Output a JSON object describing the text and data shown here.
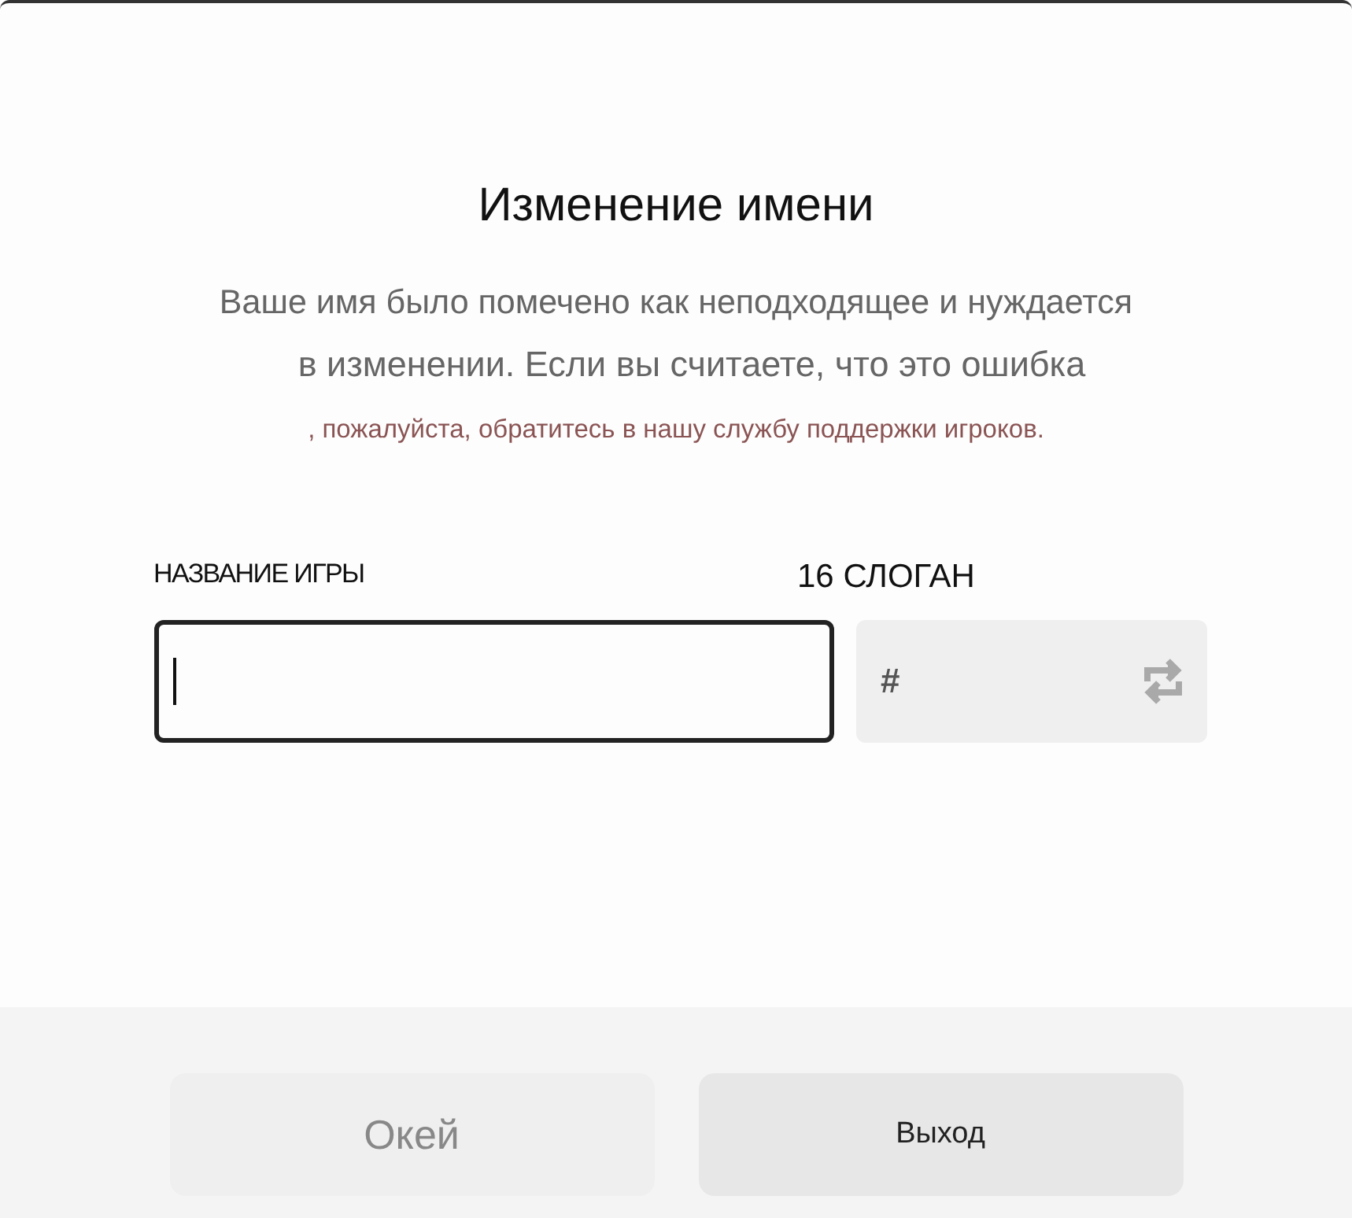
{
  "dialog": {
    "title": "Изменение имени",
    "description_lines": [
      "Ваше имя было помечено как неподходящее и нуждается",
      "в изменении. Если вы считаете, что это ошибка"
    ],
    "support_note": ", пожалуйста, обратитесь в нашу службу поддержки игроков.",
    "name_field": {
      "label": "НАЗВАНИЕ ИГРЫ",
      "focused": true
    },
    "tag_field": {
      "label": "16 СЛОГАН",
      "prefix": "#"
    },
    "buttons": [
      {
        "label": "Окей",
        "disabled": true
      },
      {
        "label": "Выход",
        "disabled": false
      }
    ]
  }
}
